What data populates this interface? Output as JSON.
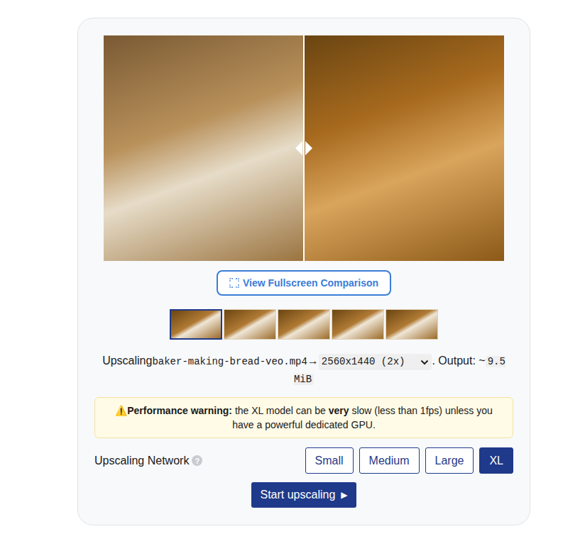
{
  "comparison": {
    "level": 0.5
  },
  "fullscreen_button": {
    "label": "View Fullscreen Comparison"
  },
  "thumbnails": [
    {
      "selected": true
    },
    {
      "selected": false
    },
    {
      "selected": false
    },
    {
      "selected": false
    },
    {
      "selected": false
    }
  ],
  "upscale": {
    "prefix": "Upscaling",
    "file": "baker-making-bread-veo.mp4",
    "arrow": "→",
    "resolution": "2560x1440 (2x)",
    "output_label": ". Output: ~",
    "output_size": "9.5 MiB"
  },
  "warning": {
    "icon": "⚠️",
    "title": "Performance warning:",
    "text_1": "the XL model can be",
    "emphasis": "very",
    "text_2": "slow (less than 1fps) unless you have a powerful dedicated GPU."
  },
  "network": {
    "label": "Upscaling Network",
    "help": "?",
    "options": [
      {
        "label": "Small",
        "selected": false
      },
      {
        "label": "Medium",
        "selected": false
      },
      {
        "label": "Large",
        "selected": false
      },
      {
        "label": "XL",
        "selected": true
      }
    ]
  },
  "start_button": {
    "label": "Start upscaling",
    "icon": "▶"
  }
}
